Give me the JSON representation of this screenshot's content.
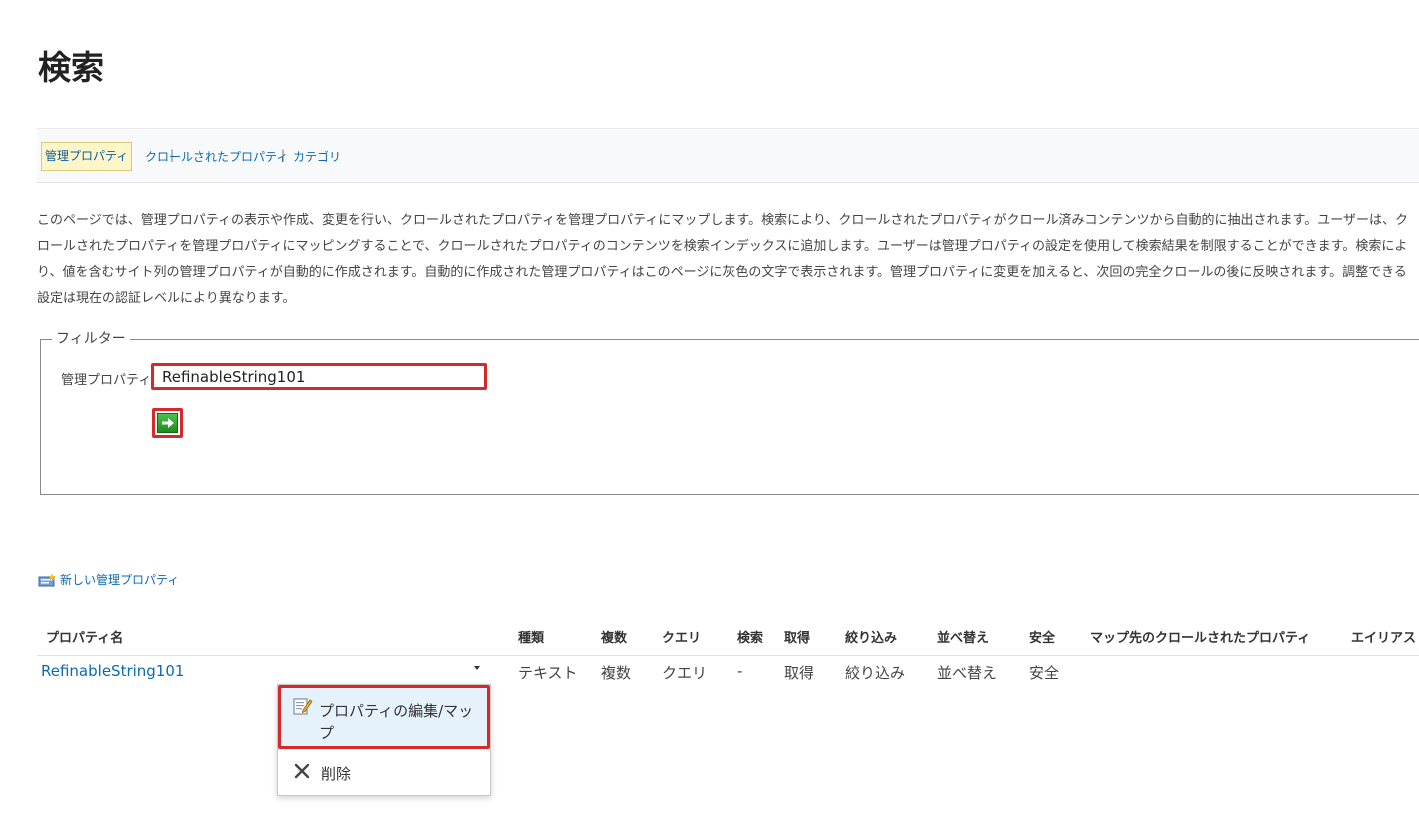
{
  "page": {
    "title": "検索"
  },
  "subnav": {
    "active_tab": "管理プロパティ",
    "separator": "|",
    "links": [
      "クロールされたプロパティ",
      "カテゴリ"
    ]
  },
  "description": "このページでは、管理プロパティの表示や作成、変更を行い、クロールされたプロパティを管理プロパティにマップします。検索により、クロールされたプロパティがクロール済みコンテンツから自動的に抽出されます。ユーザーは、クロールされたプロパティを管理プロパティにマッピングすることで、クロールされたプロパティのコンテンツを検索インデックスに追加します。ユーザーは管理プロパティの設定を使用して検索結果を制限することができます。検索により、値を含むサイト列の管理プロパティが自動的に作成されます。自動的に作成された管理プロパティはこのページに灰色の文字で表示されます。管理プロパティに変更を加えると、次回の完全クロールの後に反映されます。調整できる設定は現在の認証レベルにより異なります。",
  "filter": {
    "legend": "フィルター",
    "label": "管理プロパティ",
    "value": "RefinableString101"
  },
  "new_property_link": "新しい管理プロパティ",
  "table": {
    "headers": {
      "name": "プロパティ名",
      "type": "種類",
      "multi": "複数",
      "query": "クエリ",
      "search": "検索",
      "retrieve": "取得",
      "refine": "絞り込み",
      "sort": "並べ替え",
      "safe": "安全",
      "mapped": "マップ先のクロールされたプロパティ",
      "alias": "エイリアス"
    },
    "row": {
      "name": "RefinableString101",
      "type": "テキスト",
      "multi": "複数",
      "query": "クエリ",
      "search": "-",
      "retrieve": "取得",
      "refine": "絞り込み",
      "sort": "並べ替え",
      "safe": "安全"
    }
  },
  "context_menu": {
    "edit": "プロパティの編集/マップ",
    "delete": "削除"
  },
  "colors": {
    "link": "#0b6ab3",
    "highlight_border": "#d62a2a",
    "menu_hover": "#e6f2fb"
  }
}
